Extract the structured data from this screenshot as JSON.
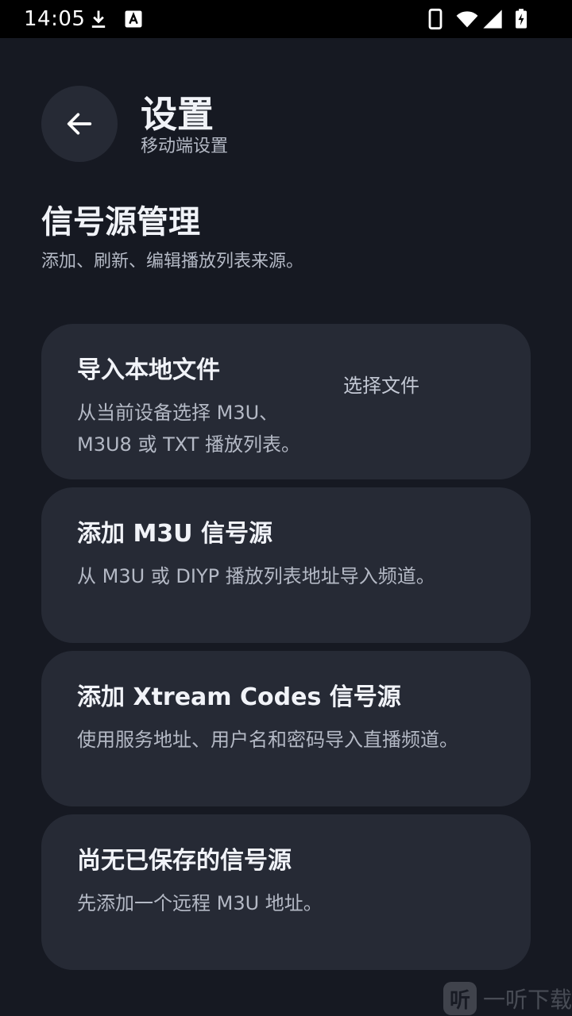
{
  "status_bar": {
    "time": "14:05"
  },
  "header": {
    "back_icon": "arrow-left-icon",
    "title": "设置",
    "subtitle": "移动端设置"
  },
  "section": {
    "title": "信号源管理",
    "description": "添加、刷新、编辑播放列表来源。"
  },
  "cards": [
    {
      "title": "导入本地文件",
      "description": "从当前设备选择 M3U、M3U8 或 TXT 播放列表。",
      "action": "选择文件"
    },
    {
      "title": "添加 M3U 信号源",
      "description": "从 M3U 或 DIYP 播放列表地址导入频道。"
    },
    {
      "title": "添加 Xtream Codes 信号源",
      "description": "使用服务地址、用户名和密码导入直播频道。"
    },
    {
      "title": "尚无已保存的信号源",
      "description": "先添加一个远程 M3U 地址。"
    }
  ],
  "watermark": {
    "logo": "听",
    "text": "一听下载"
  },
  "colors": {
    "background": "#161922",
    "card": "#262a35",
    "text_primary": "#f1f3f8",
    "text_secondary": "#b4b9c5"
  }
}
